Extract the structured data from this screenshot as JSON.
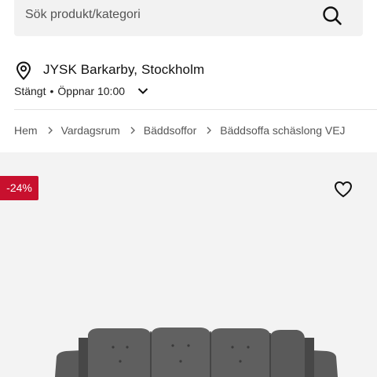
{
  "search": {
    "placeholder": "Sök produkt/kategori"
  },
  "store": {
    "name": "JYSK Barkarby, Stockholm",
    "status": "Stängt",
    "opens": "Öppnar 10:00"
  },
  "breadcrumb": [
    "Hem",
    "Vardagsrum",
    "Bäddsoffor",
    "Bäddsoffa schäslong VEJ"
  ],
  "product": {
    "discount": "-24%"
  },
  "colors": {
    "sale_red": "#c8102e",
    "media_bg": "#f3f3f3",
    "search_bg": "#f2f2f2"
  }
}
